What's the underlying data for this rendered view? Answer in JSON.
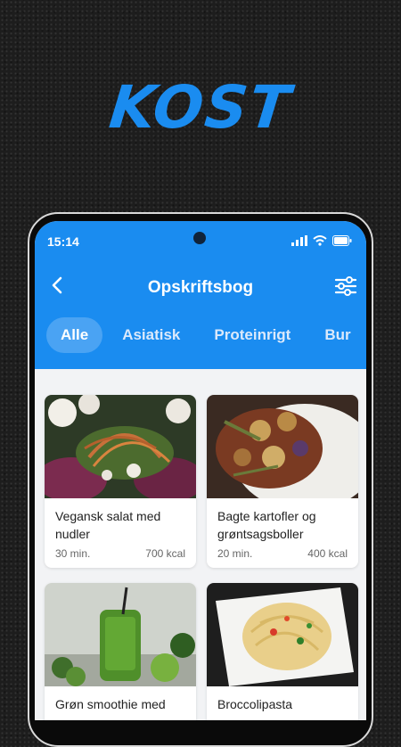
{
  "brand": "KOST",
  "status": {
    "time": "15:14"
  },
  "header": {
    "title": "Opskriftsbog"
  },
  "tabs": [
    {
      "label": "Alle",
      "active": true
    },
    {
      "label": "Asiatisk",
      "active": false
    },
    {
      "label": "Proteinrigt",
      "active": false
    },
    {
      "label": "Bur",
      "active": false
    }
  ],
  "recipes": [
    {
      "name": "Vegansk salat med nudler",
      "time": "30 min.",
      "kcal": "700 kcal"
    },
    {
      "name": "Bagte kartofler og grøntsagsboller",
      "time": "20 min.",
      "kcal": "400 kcal"
    },
    {
      "name": "Grøn smoothie med",
      "time": "",
      "kcal": ""
    },
    {
      "name": "Broccolipasta",
      "time": "",
      "kcal": ""
    }
  ],
  "colors": {
    "primary": "#1a8cf0",
    "active_tab": "#4aa3f3",
    "background": "#f2f3f5"
  }
}
